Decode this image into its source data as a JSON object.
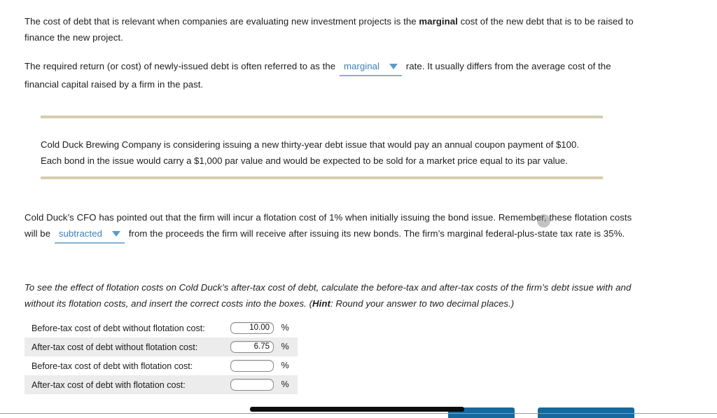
{
  "intro": {
    "text_before_bold": "The cost of debt that is relevant when companies are evaluating new investment projects is the ",
    "bold_word": "marginal",
    "text_after_bold": " cost of the new debt that is to be raised to finance the new project."
  },
  "required_return": {
    "text_before_dropdown": "The required return (or cost) of newly-issued debt is often referred to as the",
    "dropdown_value": "marginal",
    "text_after_dropdown": "rate. It usually differs from the average cost of the financial capital raised by a firm in the past."
  },
  "callout": {
    "line1": "Cold Duck Brewing Company is considering issuing a new thirty-year debt issue that would pay an annual coupon payment of $100.",
    "line2": "Each bond in the issue would carry a $1,000 par value and would be expected to be sold for a market price equal to its par value.",
    "rule_color": "#d5cdad"
  },
  "flotation": {
    "text_before_dropdown": "Cold Duck’s CFO has pointed out that the firm will incur a flotation cost of 1% when initially issuing the bond issue. Remember, these flotation costs will be",
    "dropdown_value": "subtracted",
    "text_after_dropdown": "from the proceeds the firm will receive after issuing its new bonds. The firm’s marginal federal-plus-state tax rate is 35%."
  },
  "instruction": {
    "text_part1": "To see the effect of flotation costs on Cold Duck’s after-tax cost of debt, calculate the before-tax and after-tax costs of the firm’s debt issue with and without its flotation costs, and insert the correct costs into the boxes. (",
    "hint_label": "Hint",
    "text_part2": ": Round your answer to two decimal places.)"
  },
  "answer_table": {
    "rows": [
      {
        "label": "Before-tax cost of debt without flotation cost:",
        "value": "10.00",
        "placeholder": "",
        "unit": "%",
        "striped": false
      },
      {
        "label": "After-tax cost of debt without flotation cost:",
        "value": "6.75",
        "placeholder": "",
        "unit": "%",
        "striped": true
      },
      {
        "label": "Before-tax cost of debt with flotation cost:",
        "value": "",
        "placeholder": "",
        "unit": "%",
        "striped": false
      },
      {
        "label": "After-tax cost of debt with flotation cost:",
        "value": "",
        "placeholder": "",
        "unit": "%",
        "striped": true
      }
    ]
  },
  "colors": {
    "dropdown_text": "#3d7fb5",
    "dropdown_underline": "#7fb5d8",
    "button_blue": "#16699c",
    "stripe_gray": "#ececec"
  }
}
